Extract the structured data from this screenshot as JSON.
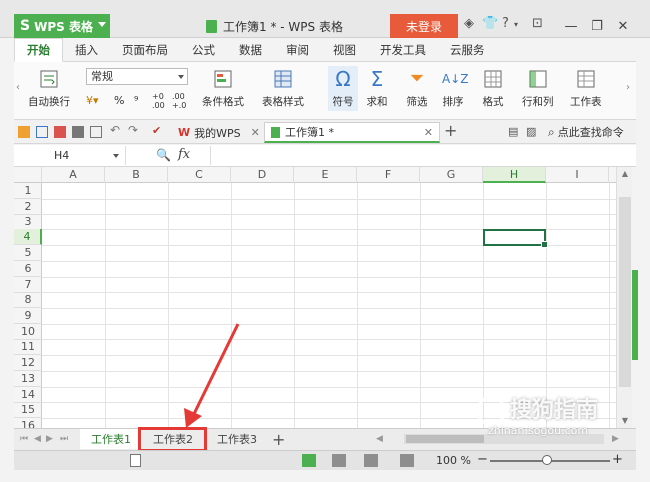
{
  "app": {
    "menu_label": "WPS 表格",
    "doc_title": "工作簿1 * - WPS 表格",
    "login_label": "未登录"
  },
  "ribbon_tabs": [
    "开始",
    "插入",
    "页面布局",
    "公式",
    "数据",
    "审阅",
    "视图",
    "开发工具",
    "云服务"
  ],
  "ribbon": {
    "wrap_text": "自动换行",
    "number_format": "常规",
    "percent": "%",
    "thousands": "⁹",
    "inc_decimal": "+0 .00",
    "dec_decimal": ".00 +.0",
    "conditional_format": "条件格式",
    "table_style": "表格样式",
    "symbol": "符号",
    "sum": "求和",
    "filter": "筛选",
    "sort": "排序",
    "format": "格式",
    "row_col": "行和列",
    "worksheet": "工作表"
  },
  "quickbar": {
    "tab_mywps": "我的WPS",
    "tab_workbook": "工作簿1 *",
    "search_label": "点此查找命令"
  },
  "formula_bar": {
    "name_box": "H4",
    "fx_label": "fx",
    "formula": ""
  },
  "grid": {
    "columns": [
      "A",
      "B",
      "C",
      "D",
      "E",
      "F",
      "G",
      "H",
      "I"
    ],
    "rows": [
      "1",
      "2",
      "3",
      "4",
      "5",
      "6",
      "7",
      "8",
      "9",
      "10",
      "11",
      "12",
      "13",
      "14",
      "15",
      "16"
    ],
    "selected_column": "H",
    "selected_row": "4"
  },
  "sheets": [
    "工作表1",
    "工作表2",
    "工作表3"
  ],
  "active_sheet": "工作表1",
  "highlighted_sheet": "工作表2",
  "status": {
    "zoom": "100 %",
    "zoom_minus": "−",
    "zoom_plus": "+"
  },
  "watermark": {
    "brand": "搜狗指南",
    "url": "zhinan.sogou.com"
  },
  "colors": {
    "accent_green": "#4caf50",
    "login_red": "#e85b3a",
    "highlight_red": "#e53935"
  }
}
